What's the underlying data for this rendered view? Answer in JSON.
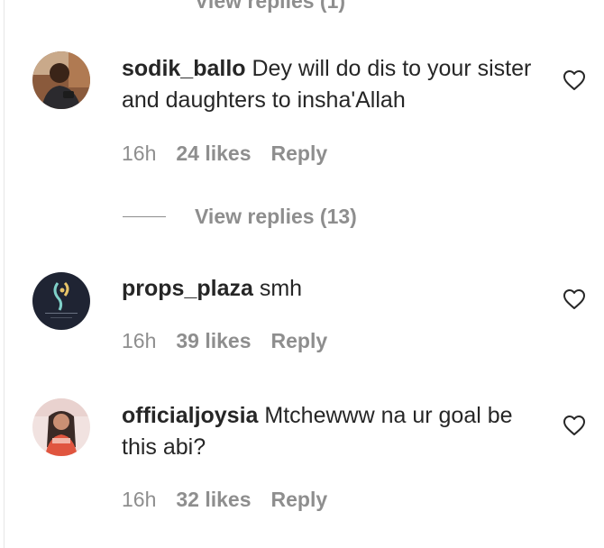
{
  "top_partial_text": "View replies (1)",
  "comments": [
    {
      "username": "sodik_ballo",
      "text": "Dey will do dis to your sister and daughters to insha'Allah",
      "time": "16h",
      "likes": "24 likes",
      "reply_label": "Reply"
    },
    {
      "username": "props_plaza",
      "text": "smh",
      "time": "16h",
      "likes": "39 likes",
      "reply_label": "Reply",
      "avatar_logo_text": "PROPS PLAZA"
    },
    {
      "username": "officialjoysia",
      "text": "Mtchewww na ur goal be this abi?",
      "time": "16h",
      "likes": "32 likes",
      "reply_label": "Reply"
    }
  ],
  "view_replies": {
    "label": "View replies (13)"
  },
  "icons": {
    "like": "heart-outline-icon"
  },
  "colors": {
    "text": "#262626",
    "secondary": "#8e8e8e",
    "background": "#ffffff"
  }
}
